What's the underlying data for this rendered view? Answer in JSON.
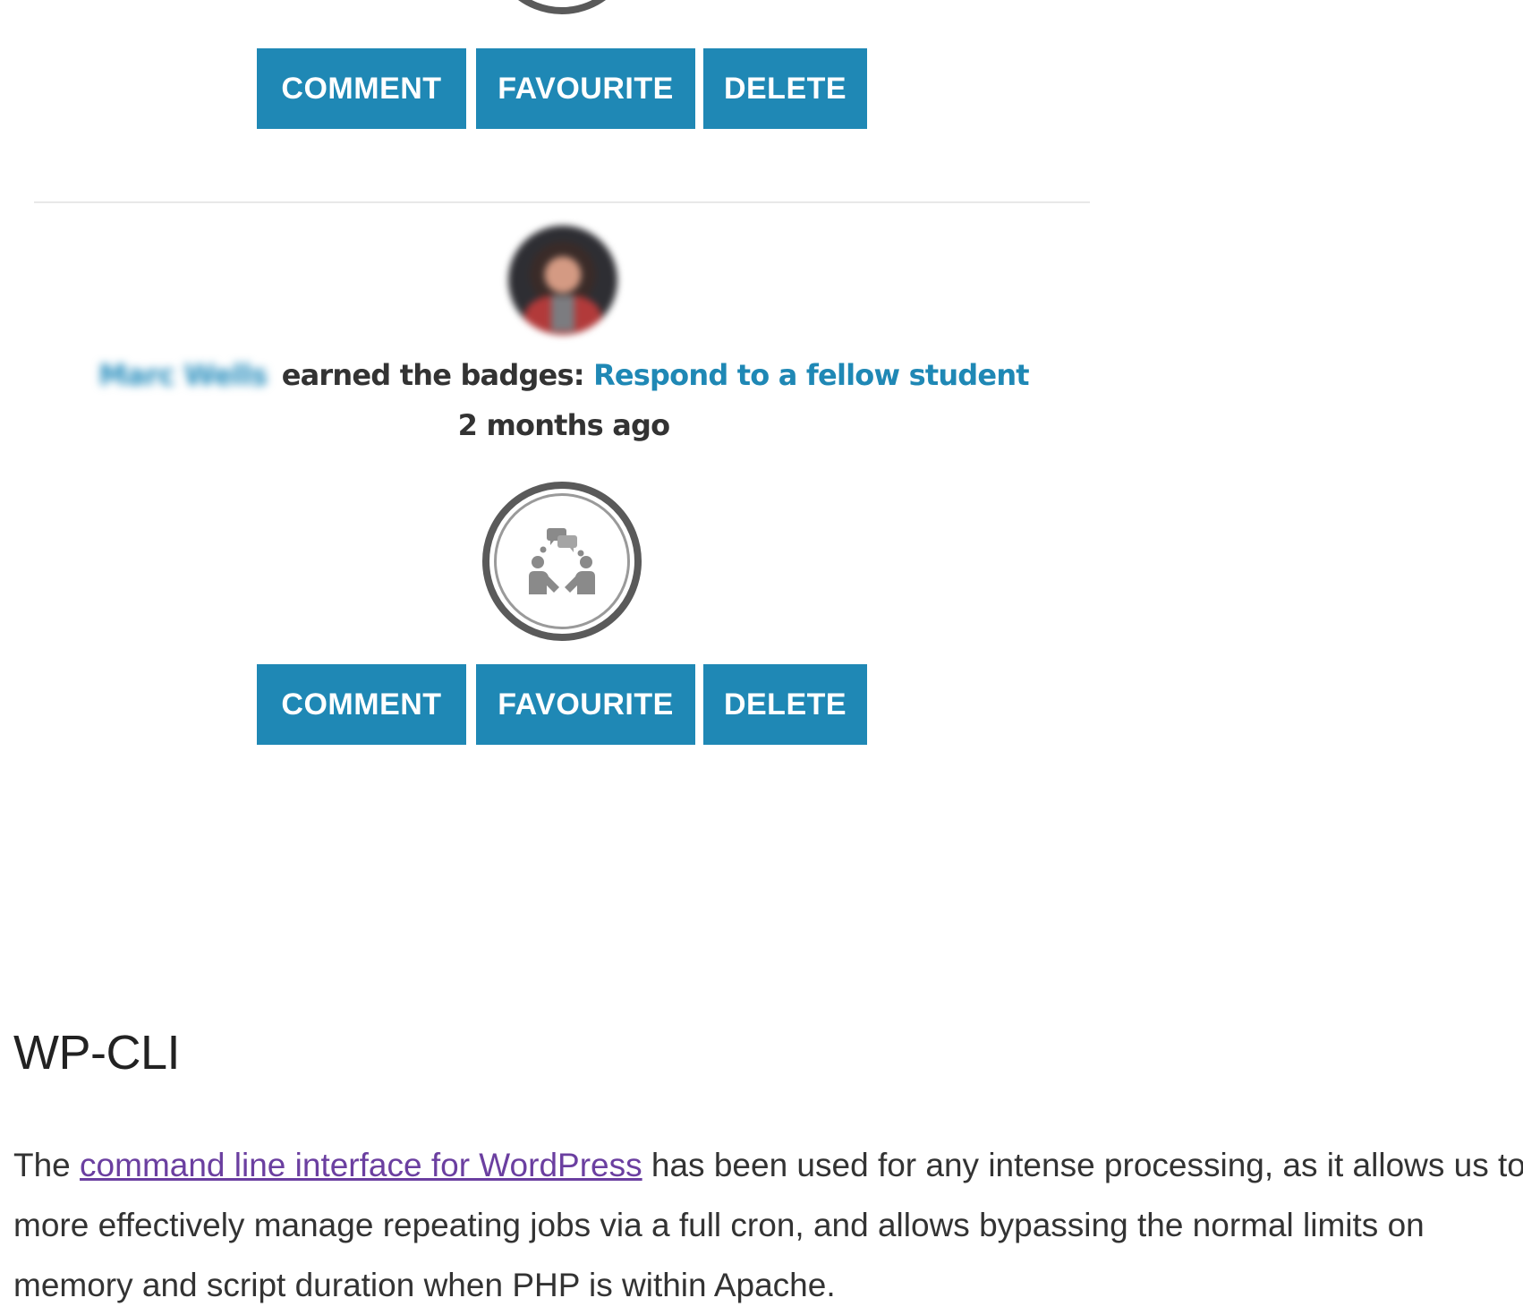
{
  "activity_top": {
    "actions": {
      "comment_label": "COMMENT",
      "favourite_label": "FAVOURITE",
      "delete_label": "DELETE"
    }
  },
  "activity_item": {
    "username": "Marc Wells",
    "action_text": " earned the badges: ",
    "badge_name": "Respond to a fellow student",
    "timestamp": "2 months ago",
    "badge_icon": "conversation-people-icon",
    "actions": {
      "comment_label": "COMMENT",
      "favourite_label": "FAVOURITE",
      "delete_label": "DELETE"
    }
  },
  "article": {
    "heading": "WP-CLI",
    "paragraph_prefix": "The ",
    "link_text": "command line interface for WordPress",
    "paragraph_suffix": " has been used for any intense processing, as it allows us to more effectively manage repeating jobs via a full cron, and allows bypassing the normal limits on memory and script duration when PHP is within Apache."
  },
  "colors": {
    "button_bg": "#1f88b5",
    "link_blue": "#1f88b5",
    "article_link": "#6b3fa0",
    "text": "#333333"
  }
}
